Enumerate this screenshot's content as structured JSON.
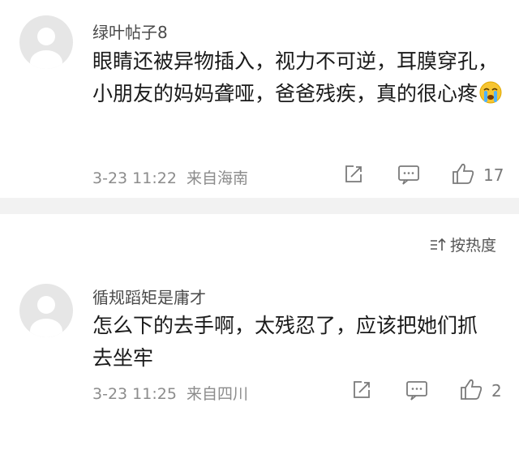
{
  "comments": [
    {
      "username": "绿叶帖子8",
      "text": "眼睛还被异物插入，视力不可逆，耳膜穿孔，小朋友的妈妈聋哑，爸爸残疾，真的很心疼",
      "emoji": "crying-face-emoji",
      "date": "3-23 11:22",
      "location": "来自海南",
      "likes": "17"
    },
    {
      "username": "循规蹈矩是庸才",
      "text": "怎么下的去手啊，太残忍了，应该把她们抓去坐牢",
      "date": "3-23 11:25",
      "location": "来自四川",
      "likes": "2"
    }
  ],
  "sort": {
    "label": "按热度"
  },
  "colors": {
    "divider": "#f2f2f2",
    "meta": "#8c8c8c",
    "avatar": "#e6e6e6"
  }
}
